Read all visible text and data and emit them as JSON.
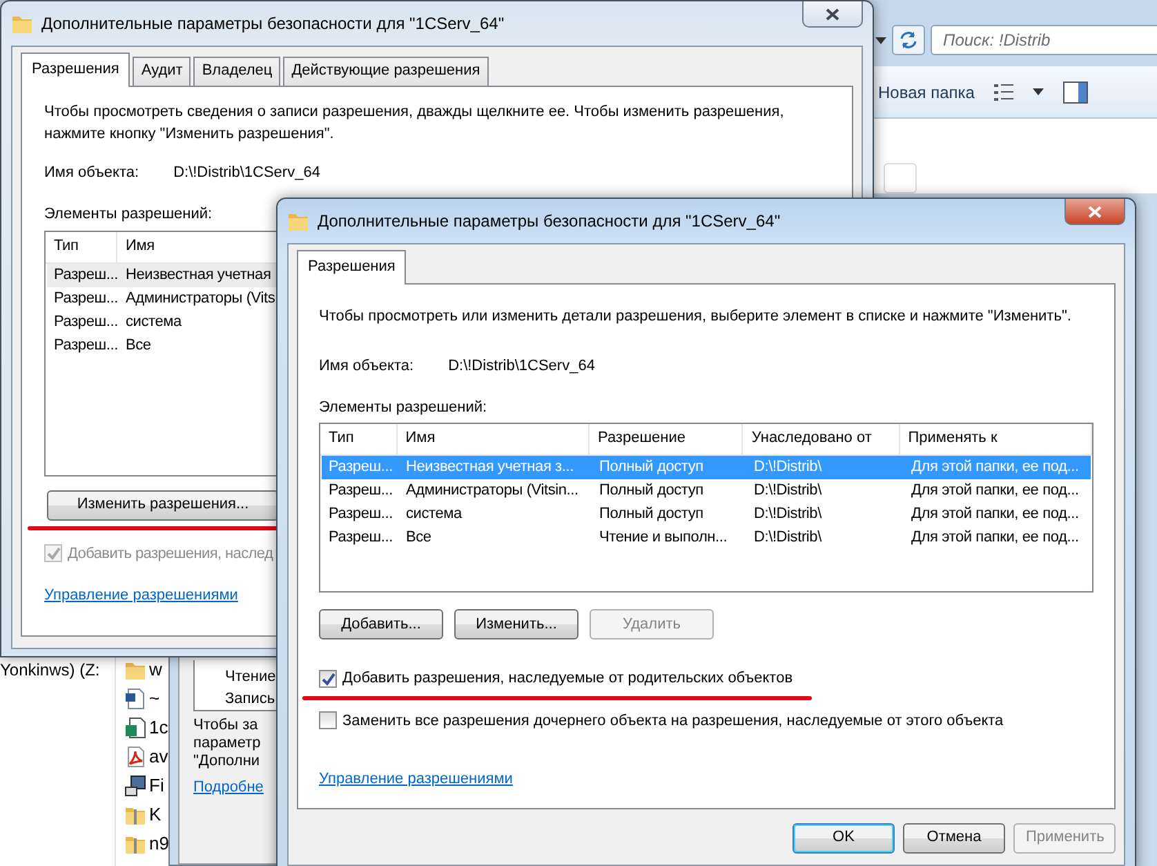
{
  "explorer": {
    "search": {
      "placeholder": "Поиск: !Distrib"
    },
    "toolbar_button": "Новая папка",
    "nav_item": "Yonkinws) (Z:",
    "files": [
      {
        "kind": "folder",
        "name": "w"
      },
      {
        "kind": "word",
        "name": "~"
      },
      {
        "kind": "exe",
        "name": "1c"
      },
      {
        "kind": "pdf",
        "name": "av"
      },
      {
        "kind": "setup",
        "name": "Fi"
      },
      {
        "kind": "archive",
        "name": "K"
      },
      {
        "kind": "archive",
        "name": "n9"
      }
    ]
  },
  "back_dialog": {
    "list_items": [
      "Чтение",
      "Запись"
    ],
    "text_lines": [
      "Чтобы за",
      "параметр",
      "\"Дополни"
    ],
    "link": "Подробне"
  },
  "dialog_1": {
    "title": "Дополнительные параметры безопасности  для \"1CServ_64\"",
    "active": false,
    "tabs": [
      {
        "label": "Разрешения",
        "selected": true
      },
      {
        "label": "Аудит",
        "selected": false
      },
      {
        "label": "Владелец",
        "selected": false
      },
      {
        "label": "Действующие разрешения",
        "selected": false
      }
    ],
    "description_lines": [
      "Чтобы просмотреть сведения о записи разрешения, дважды щелкните ее. Чтобы изменить разрешения,",
      "нажмите кнопку \"Изменить разрешения\"."
    ],
    "object_label": "Имя объекта:",
    "object_value": "D:\\!Distrib\\1CServ_64",
    "entries_label": "Элементы разрешений:",
    "table": {
      "columns": [
        "Тип",
        "Имя"
      ],
      "rows": [
        {
          "selected": true,
          "cells": [
            "Разреш...",
            "Неизвестная учетная"
          ]
        },
        {
          "selected": false,
          "cells": [
            "Разреш...",
            "Администраторы (Vits"
          ]
        },
        {
          "selected": false,
          "cells": [
            "Разреш...",
            "система"
          ]
        },
        {
          "selected": false,
          "cells": [
            "Разреш...",
            "Все"
          ]
        }
      ]
    },
    "change_button": {
      "label": "Изменить разрешения...",
      "underlined": true
    },
    "inherit_checkbox": {
      "label": "Добавить разрешения, наслед",
      "checked": true,
      "disabled": true
    },
    "link": "Управление разрешениями"
  },
  "dialog_2": {
    "title": "Дополнительные параметры безопасности  для \"1CServ_64\"",
    "active": true,
    "tabs": [
      {
        "label": "Разрешения",
        "selected": true
      }
    ],
    "description": "Чтобы просмотреть или изменить детали разрешения, выберите элемент в списке и нажмите \"Изменить\".",
    "object_label": "Имя объекта:",
    "object_value": "D:\\!Distrib\\1CServ_64",
    "entries_label": "Элементы разрешений:",
    "table": {
      "columns": [
        "Тип",
        "Имя",
        "Разрешение",
        "Унаследовано от",
        "Применять к"
      ],
      "rows": [
        {
          "selected": true,
          "cells": [
            "Разреш...",
            "Неизвестная учетная з...",
            "Полный доступ",
            "D:\\!Distrib\\",
            "Для этой папки, ее под..."
          ]
        },
        {
          "selected": false,
          "cells": [
            "Разреш...",
            "Администраторы (Vitsin...",
            "Полный доступ",
            "D:\\!Distrib\\",
            "Для этой папки, ее под..."
          ]
        },
        {
          "selected": false,
          "cells": [
            "Разреш...",
            "система",
            "Полный доступ",
            "D:\\!Distrib\\",
            "Для этой папки, ее под..."
          ]
        },
        {
          "selected": false,
          "cells": [
            "Разреш...",
            "Все",
            "Чтение и выполн...",
            "D:\\!Distrib\\",
            "Для этой папки, ее под..."
          ]
        }
      ]
    },
    "buttons": [
      {
        "label": "Добавить...",
        "disabled": false
      },
      {
        "label": "Изменить...",
        "disabled": false
      },
      {
        "label": "Удалить",
        "disabled": true
      }
    ],
    "checkboxes": [
      {
        "label": "Добавить разрешения, наследуемые от родительских объектов",
        "checked": true,
        "underlined": true
      },
      {
        "label": "Заменить все разрешения дочернего объекта на разрешения, наследуемые от этого объекта",
        "checked": false,
        "underlined": false
      }
    ],
    "link": "Управление разрешениями",
    "footer_buttons": [
      {
        "label": "OK",
        "default": true,
        "disabled": false
      },
      {
        "label": "Отмена",
        "default": false,
        "disabled": false
      },
      {
        "label": "Применить",
        "default": false,
        "disabled": true
      }
    ]
  }
}
